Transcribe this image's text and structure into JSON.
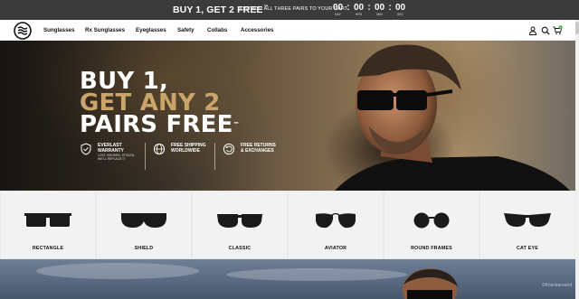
{
  "promo": {
    "headline": "BUY 1, GET 2 FREE",
    "trademark": "™",
    "subtext": "JUST ADD ALL THREE PAIRS TO YOUR CART",
    "countdown": [
      {
        "value": "00",
        "label": "DAY"
      },
      {
        "value": "00",
        "label": "HRS"
      },
      {
        "value": "00",
        "label": "MIN"
      },
      {
        "value": "00",
        "label": "SEC"
      }
    ],
    "separator": ":"
  },
  "nav": {
    "items": [
      "Sunglasses",
      "Rx Sunglasses",
      "Eyeglasses",
      "Safety",
      "Collabs",
      "Accessories"
    ],
    "icons": [
      "account-icon",
      "search-icon",
      "cart-icon"
    ],
    "cart_count": "0"
  },
  "hero": {
    "line1": "BUY 1,",
    "line2": "GET ANY 2",
    "line3": "PAIRS FREE",
    "trademark": "™",
    "benefits": [
      {
        "title": "EVERLAST WARRANTY",
        "note": "LOST, BROKEN, STOLEN, WE'LL REPLACE IT.",
        "icon": "shield-check-icon"
      },
      {
        "title": "FREE SHIPPING WORLDWIDE",
        "note": "",
        "icon": "globe-icon"
      },
      {
        "title": "FREE RETURNS & EXCHANGES",
        "note": "",
        "icon": "returns-icon"
      }
    ],
    "accent_color": "#c9a56a"
  },
  "categories": [
    "RECTANGLE",
    "SHIELD",
    "CLASSIC",
    "AVIATOR",
    "ROUND FRAMES",
    "CAT EYE"
  ],
  "banner2": {
    "watermark": "©Knockaround"
  }
}
